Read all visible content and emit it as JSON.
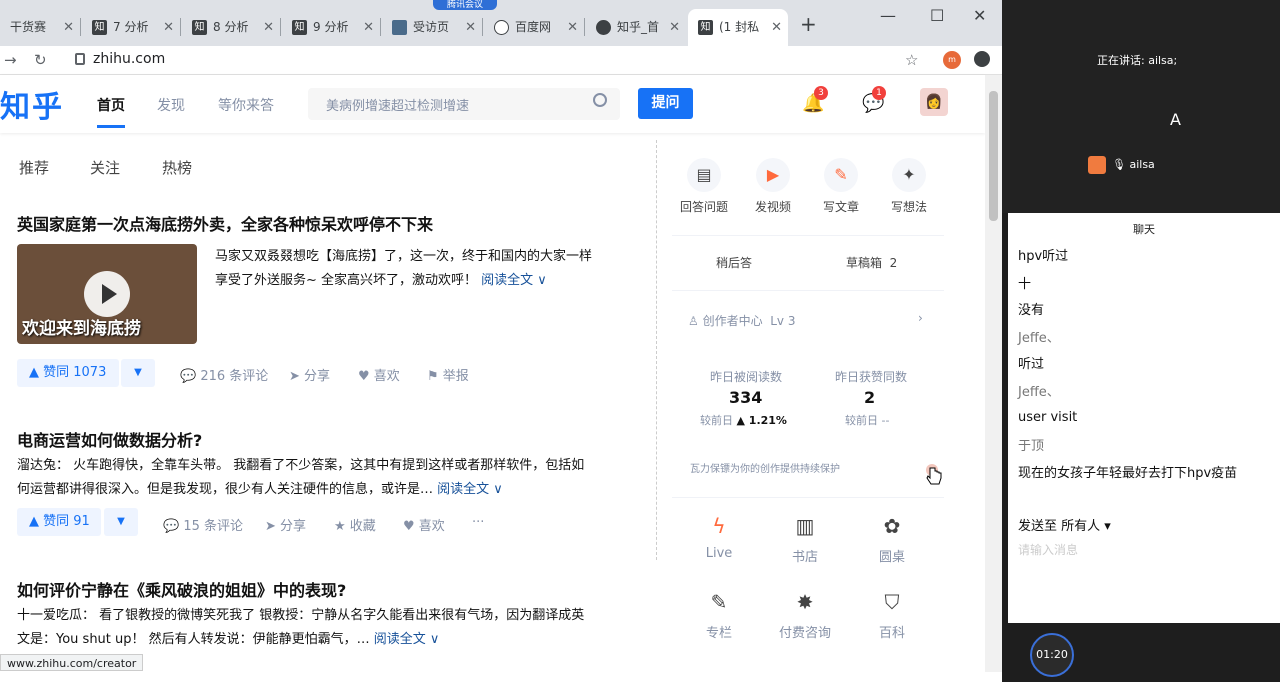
{
  "browser": {
    "tabs": [
      {
        "label": "干货赛",
        "fav": ""
      },
      {
        "label": "7 分析",
        "fav": "知"
      },
      {
        "label": "8 分析",
        "fav": "知"
      },
      {
        "label": "9 分析",
        "fav": "知"
      },
      {
        "label": "受访页",
        "fav": ""
      },
      {
        "label": "百度网",
        "fav": ""
      },
      {
        "label": "知乎_首",
        "fav": ""
      },
      {
        "label": "(1 封私",
        "fav": "知"
      }
    ],
    "new_tab": "+",
    "url": "zhihu.com",
    "meeting_label": "腾讯会议",
    "status_url": "www.zhihu.com/creator",
    "profile_initial": "m"
  },
  "zhihu": {
    "logo": "知乎",
    "nav": [
      "首页",
      "发现",
      "等你来答"
    ],
    "search_placeholder": "美病例增速超过检测增速",
    "ask_button": "提问",
    "notif_count": "3",
    "msg_count": "1",
    "subtabs": [
      "推荐",
      "关注",
      "热榜"
    ],
    "feed": [
      {
        "title": "英国家庭第一次点海底捞外卖，全家各种惊呆欢呼停不下来",
        "line1": "马家又双叒叕想吃【海底捞】了，这一次，终于和国内的大家一样",
        "line2": "享受了外送服务~ 全家高兴坏了，激动欢呼！",
        "readmore": "阅读全文 ∨",
        "thumb_caption": "欢迎来到海底捞",
        "vote": "▲ 赞同 1073",
        "comments": "216 条评论",
        "share": "分享",
        "like": "喜欢",
        "report": "举报"
      },
      {
        "title": "电商运营如何做数据分析?",
        "line1": "溜达兔： 火车跑得快，全靠车头带。 我翻看了不少答案，这其中有提到这样或者那样软件，包括如",
        "line2": "何运营都讲得很深入。但是我发现，很少有人关注硬件的信息，或许是…",
        "readmore": "阅读全文 ∨",
        "vote": "▲ 赞同 91",
        "comments": "15 条评论",
        "share": "分享",
        "collect": "收藏",
        "like": "喜欢",
        "more": "···"
      },
      {
        "title": "如何评价宁静在《乘风破浪的姐姐》中的表现?",
        "line1": "十一爱吃瓜： 看了银教授的微博笑死我了 银教授：宁静从名字久能看出来很有气场，因为翻译成英",
        "line2": "文是：You shut up！ 然后有人转发说：伊能静更怕霸气，…",
        "readmore": "阅读全文 ∨"
      }
    ],
    "sidebar": {
      "actions": [
        "回答问题",
        "发视频",
        "写文章",
        "写想法"
      ],
      "later": "稍后答",
      "drafts": "草稿箱",
      "drafts_count": "2",
      "creator": "创作者中心",
      "level": "Lv 3",
      "read_label": "昨日被阅读数",
      "read_value": "334",
      "read_change_label": "较前日",
      "read_change": "▲ 1.21%",
      "like_label": "昨日获赞同数",
      "like_value": "2",
      "like_change_label": "较前日",
      "like_change": "--",
      "protect": "瓦力保镖为你的创作提供持续保护",
      "bottom": [
        "Live",
        "书店",
        "圆桌",
        "专栏",
        "付费咨询",
        "百科"
      ]
    }
  },
  "meeting": {
    "speaking": "正在讲话: ailsa;",
    "avatar_letter": "A",
    "user": "ailsa",
    "chat_title": "聊天",
    "messages": [
      {
        "text": "hpv听过",
        "name": false
      },
      {
        "text": "十",
        "name": false
      },
      {
        "text": "没有",
        "name": false
      },
      {
        "text": "Jeffe、",
        "name": true
      },
      {
        "text": "听过",
        "name": false
      },
      {
        "text": "Jeffe、",
        "name": true
      },
      {
        "text": "user visit",
        "name": false
      },
      {
        "text": "于顶",
        "name": true
      },
      {
        "text": "现在的女孩子年轻最好去打下hpv疫苗",
        "name": false
      }
    ],
    "send_to": "发送至 所有人 ▾",
    "input_placeholder": "请输入消息",
    "timer": "01:20"
  }
}
